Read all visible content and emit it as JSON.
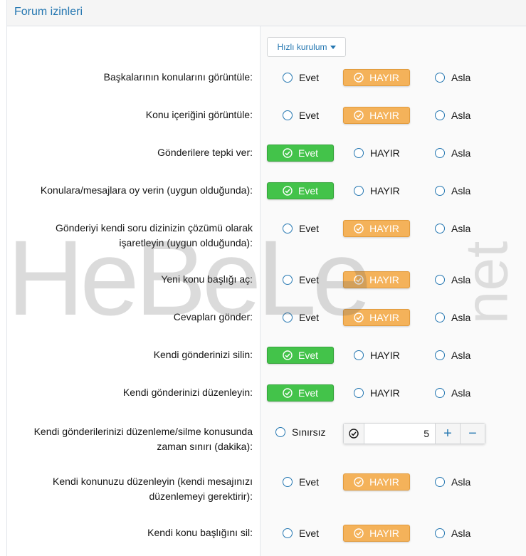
{
  "header": {
    "title": "Forum izinleri"
  },
  "quick_setup": {
    "label": "Hızlı kurulum"
  },
  "options": {
    "yes": "Evet",
    "no": "HAYIR",
    "never": "Asla"
  },
  "permissions": [
    {
      "label": "Başkalarının konularını görüntüle:",
      "selected": "no"
    },
    {
      "label": "Konu içeriğini görüntüle:",
      "selected": "no"
    },
    {
      "label": "Gönderilere tepki ver:",
      "selected": "yes"
    },
    {
      "label": "Konulara/mesajlara oy verin (uygun olduğunda):",
      "selected": "yes"
    },
    {
      "label_line1": "Gönderiyi kendi soru dizinizin çözümü olarak",
      "label_line2": "işaretleyin (uygun olduğunda):",
      "selected": "no"
    },
    {
      "label": "Yeni konu başlığı aç:",
      "selected": "no"
    },
    {
      "label": "Cevapları gönder:",
      "selected": "no"
    },
    {
      "label": "Kendi gönderinizi silin:",
      "selected": "yes"
    },
    {
      "label": "Kendi gönderinizi düzenleyin:",
      "selected": "yes"
    },
    {
      "label_line1": "Kendi gönderilerinizi düzenleme/silme konusunda",
      "label_line2": "zaman sınırı (dakika):",
      "unlimited_label": "Sınırsız",
      "value": "5",
      "plus": "+",
      "minus": "−"
    },
    {
      "label_line1": "Kendi konunuzu düzenleyin (kendi mesajınızı",
      "label_line2": "düzenlemeyi gerektirir):",
      "selected": "no"
    },
    {
      "label": "Kendi konu başlığını sil:",
      "selected": "no"
    }
  ],
  "watermark": {
    "main": "HeBeLe",
    "side": "net"
  },
  "colors": {
    "accent": "#2577b1",
    "selected_yes": "#43c34a",
    "selected_no": "#f4b25a"
  }
}
